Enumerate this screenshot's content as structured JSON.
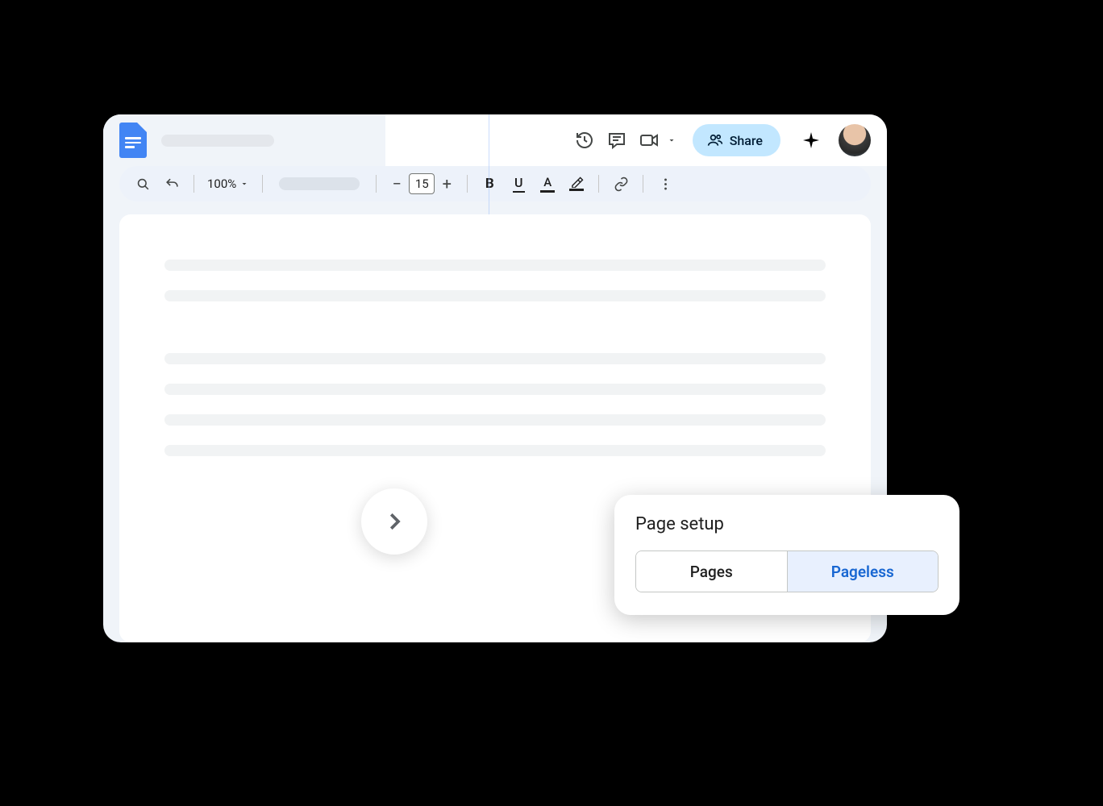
{
  "header": {
    "share_label": "Share"
  },
  "toolbar": {
    "zoom": "100%",
    "font_size": "15"
  },
  "page_setup": {
    "title": "Page setup",
    "option_pages": "Pages",
    "option_pageless": "Pageless"
  }
}
